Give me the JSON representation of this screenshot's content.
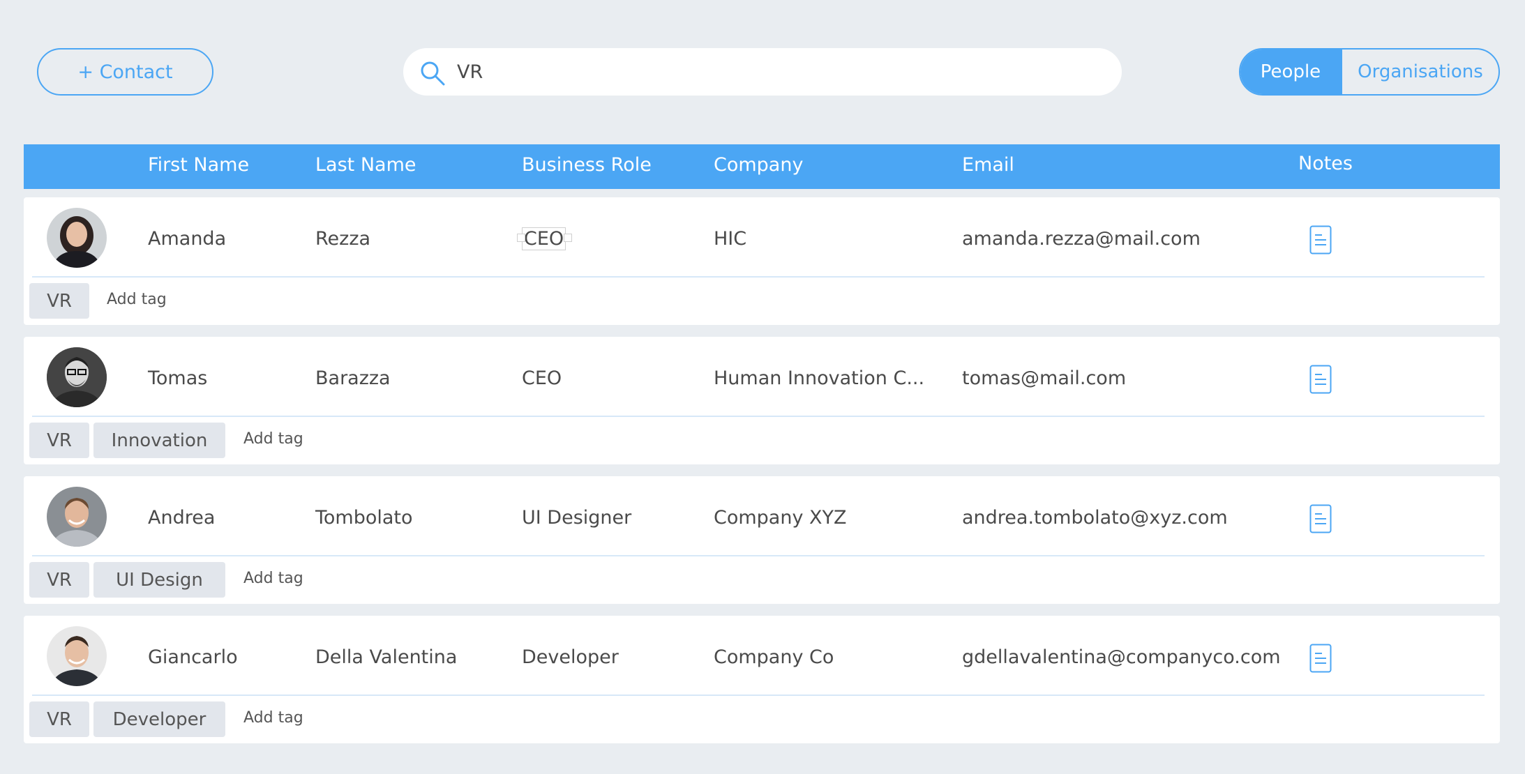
{
  "toolbar": {
    "add_contact_label": "+ Contact",
    "search_value": "VR",
    "search_placeholder": "",
    "toggle_people": "People",
    "toggle_organisations": "Organisations"
  },
  "colors": {
    "accent": "#4ba6f4",
    "background": "#e9edf1",
    "tag_bg": "#e2e6ec"
  },
  "table": {
    "headers": {
      "first_name": "First Name",
      "last_name": "Last Name",
      "business_role": "Business Role",
      "company": "Company",
      "email": "Email",
      "notes": "Notes"
    },
    "rows": [
      {
        "first_name": "Amanda",
        "last_name": "Rezza",
        "business_role": "CEO",
        "company": "HIC",
        "email": "amanda.rezza@mail.com",
        "tags": [
          "VR"
        ],
        "add_tag": "Add tag",
        "avatar": "avatar-woman-dark-hair",
        "notes_icon": "document-icon"
      },
      {
        "first_name": "Tomas",
        "last_name": "Barazza",
        "business_role": "CEO",
        "company": "Human Innovation C...",
        "email": "tomas@mail.com",
        "tags": [
          "VR",
          "Innovation"
        ],
        "add_tag": "Add tag",
        "avatar": "avatar-man-glasses",
        "notes_icon": "document-icon"
      },
      {
        "first_name": "Andrea",
        "last_name": "Tombolato",
        "business_role": "UI Designer",
        "company": "Company XYZ",
        "email": "andrea.tombolato@xyz.com",
        "tags": [
          "VR",
          "UI Design"
        ],
        "add_tag": "Add tag",
        "avatar": "avatar-man-smiling",
        "notes_icon": "document-icon"
      },
      {
        "first_name": "Giancarlo",
        "last_name": "Della Valentina",
        "business_role": "Developer",
        "company": "Company Co",
        "email": "gdellavalentina@companyco.com",
        "tags": [
          "VR",
          "Developer"
        ],
        "add_tag": "Add tag",
        "avatar": "avatar-man-short-hair",
        "notes_icon": "document-icon"
      }
    ]
  }
}
